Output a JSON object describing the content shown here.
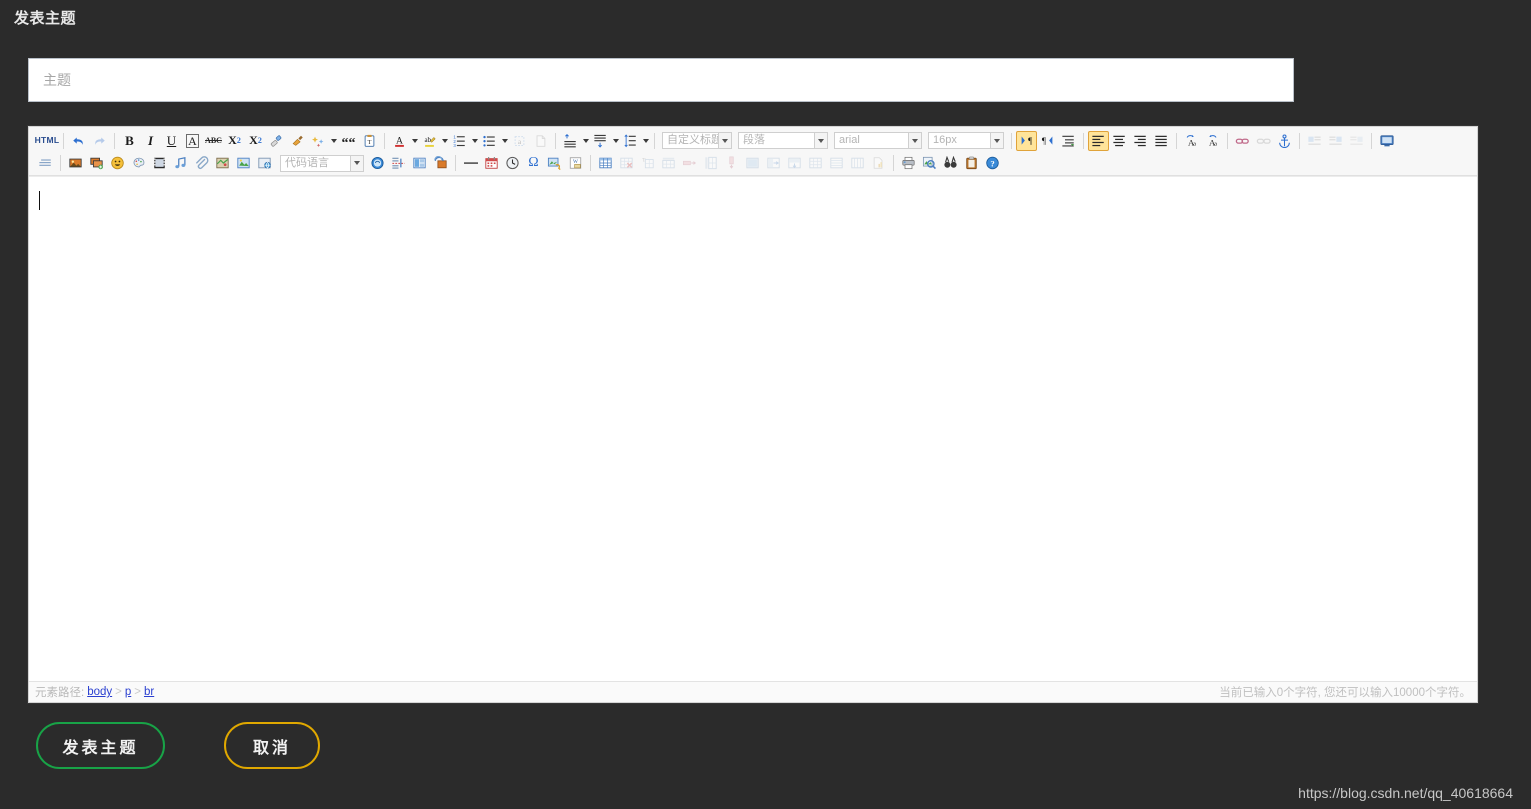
{
  "page": {
    "title": "发表主题",
    "watermark": "https://blog.csdn.net/qq_40618664"
  },
  "subject": {
    "placeholder": "主题",
    "value": ""
  },
  "editor": {
    "toolbar_row1": [
      {
        "name": "html-source-button",
        "label": "HTML",
        "kind": "text",
        "state": "normal"
      },
      {
        "name": "separator",
        "kind": "sep"
      },
      {
        "name": "undo-icon",
        "kind": "icon",
        "state": "normal"
      },
      {
        "name": "redo-icon",
        "kind": "icon",
        "state": "disabled"
      },
      {
        "name": "separator",
        "kind": "sep"
      },
      {
        "name": "bold-icon",
        "label": "B",
        "kind": "text",
        "state": "normal"
      },
      {
        "name": "italic-icon",
        "label": "I",
        "kind": "text",
        "state": "normal"
      },
      {
        "name": "underline-icon",
        "label": "U",
        "kind": "text",
        "state": "normal"
      },
      {
        "name": "font-border-icon",
        "label": "A",
        "kind": "text",
        "state": "normal"
      },
      {
        "name": "strikethrough-icon",
        "label": "ABC",
        "kind": "text",
        "state": "normal"
      },
      {
        "name": "superscript-icon",
        "kind": "icon",
        "state": "normal"
      },
      {
        "name": "subscript-icon",
        "kind": "icon",
        "state": "normal"
      },
      {
        "name": "remove-format-icon",
        "kind": "icon",
        "state": "normal"
      },
      {
        "name": "format-painter-icon",
        "kind": "icon",
        "state": "normal"
      },
      {
        "name": "auto-typeset-icon",
        "kind": "icon",
        "state": "normal"
      },
      {
        "name": "blockquote-icon",
        "kind": "icon",
        "state": "normal"
      },
      {
        "name": "paste-plain-text-icon",
        "kind": "icon",
        "state": "normal"
      },
      {
        "name": "separator",
        "kind": "sep"
      },
      {
        "name": "font-color-icon",
        "kind": "icon",
        "state": "normal"
      },
      {
        "name": "highlight-color-icon",
        "kind": "icon",
        "state": "normal"
      },
      {
        "name": "ordered-list-icon",
        "kind": "icon",
        "state": "normal"
      },
      {
        "name": "unordered-list-icon",
        "kind": "icon",
        "state": "normal"
      },
      {
        "name": "anchor-text-icon",
        "kind": "icon",
        "state": "disabled"
      },
      {
        "name": "blank-page-icon",
        "kind": "icon",
        "state": "disabled"
      },
      {
        "name": "separator",
        "kind": "sep"
      },
      {
        "name": "paragraph-spacing-top-icon",
        "kind": "icon",
        "state": "normal"
      },
      {
        "name": "paragraph-spacing-bottom-icon",
        "kind": "icon",
        "state": "normal"
      },
      {
        "name": "line-height-icon",
        "kind": "icon",
        "state": "normal"
      }
    ],
    "selects": [
      {
        "name": "custom-heading-select",
        "value": "自定义标题"
      },
      {
        "name": "paragraph-format-select",
        "value": "段落"
      },
      {
        "name": "font-family-select",
        "value": "arial"
      },
      {
        "name": "font-size-select",
        "value": "16px"
      }
    ],
    "toolbar_row1_right": [
      {
        "name": "direction-ltr-icon",
        "kind": "icon",
        "state": "active"
      },
      {
        "name": "direction-rtl-icon",
        "kind": "icon",
        "state": "normal"
      },
      {
        "name": "indent-icon",
        "kind": "icon",
        "state": "normal"
      },
      {
        "name": "separator",
        "kind": "sep"
      },
      {
        "name": "align-left-icon",
        "kind": "icon",
        "state": "active"
      },
      {
        "name": "align-center-icon",
        "kind": "icon",
        "state": "normal"
      },
      {
        "name": "align-right-icon",
        "kind": "icon",
        "state": "normal"
      },
      {
        "name": "align-justify-icon",
        "kind": "icon",
        "state": "normal"
      },
      {
        "name": "separator",
        "kind": "sep"
      },
      {
        "name": "uppercase-icon",
        "kind": "icon",
        "state": "normal"
      },
      {
        "name": "lowercase-icon",
        "kind": "icon",
        "state": "normal"
      },
      {
        "name": "insert-link-icon",
        "kind": "icon",
        "state": "normal"
      },
      {
        "name": "unlink-icon",
        "kind": "icon",
        "state": "disabled"
      },
      {
        "name": "anchor-icon",
        "kind": "icon",
        "state": "normal"
      },
      {
        "name": "separator",
        "kind": "sep"
      },
      {
        "name": "image-float-left-icon",
        "kind": "icon",
        "state": "disabled"
      },
      {
        "name": "image-float-right-icon",
        "kind": "icon",
        "state": "disabled"
      },
      {
        "name": "image-float-none-icon",
        "kind": "icon",
        "state": "disabled"
      },
      {
        "name": "fullscreen-icon",
        "kind": "icon",
        "state": "normal"
      }
    ],
    "toolbar_row2": [
      {
        "name": "text-indent-icon",
        "kind": "icon",
        "state": "normal"
      },
      {
        "name": "separator",
        "kind": "sep"
      },
      {
        "name": "insert-image-icon",
        "kind": "icon",
        "state": "normal"
      },
      {
        "name": "batch-image-icon",
        "kind": "icon",
        "state": "normal"
      },
      {
        "name": "emoticon-icon",
        "kind": "icon",
        "state": "normal"
      },
      {
        "name": "scrawl-icon",
        "kind": "icon",
        "state": "normal"
      },
      {
        "name": "insert-video-icon",
        "kind": "icon",
        "state": "normal"
      },
      {
        "name": "insert-music-icon",
        "kind": "icon",
        "state": "normal"
      },
      {
        "name": "attachment-icon",
        "kind": "icon",
        "state": "normal"
      },
      {
        "name": "map-icon",
        "kind": "icon",
        "state": "normal"
      },
      {
        "name": "insert-frame-icon",
        "kind": "icon",
        "state": "normal"
      },
      {
        "name": "webapp-icon",
        "kind": "icon",
        "state": "normal"
      }
    ],
    "code_language_select": {
      "name": "code-language-select",
      "value": "代码语言"
    },
    "toolbar_row2_mid": [
      {
        "name": "insert-code-icon",
        "kind": "icon",
        "state": "normal"
      },
      {
        "name": "page-break-icon",
        "kind": "icon",
        "state": "normal"
      },
      {
        "name": "template-icon",
        "kind": "icon",
        "state": "normal"
      },
      {
        "name": "background-icon",
        "kind": "icon",
        "state": "normal"
      },
      {
        "name": "separator",
        "kind": "sep"
      },
      {
        "name": "horizontal-rule-icon",
        "kind": "icon",
        "state": "normal"
      },
      {
        "name": "calendar-icon",
        "kind": "icon",
        "state": "normal"
      },
      {
        "name": "time-icon",
        "kind": "icon",
        "state": "normal"
      },
      {
        "name": "special-character-icon",
        "kind": "icon",
        "state": "normal"
      },
      {
        "name": "seo-icon",
        "kind": "icon",
        "state": "normal"
      },
      {
        "name": "import-word-icon",
        "kind": "icon",
        "state": "normal"
      },
      {
        "name": "separator",
        "kind": "sep"
      },
      {
        "name": "insert-table-icon",
        "kind": "icon",
        "state": "normal"
      },
      {
        "name": "delete-table-icon",
        "kind": "icon",
        "state": "disabled"
      },
      {
        "name": "table-title-icon",
        "kind": "icon",
        "state": "disabled"
      },
      {
        "name": "insert-row-icon",
        "kind": "icon",
        "state": "disabled"
      },
      {
        "name": "delete-row-icon",
        "kind": "icon",
        "state": "disabled"
      },
      {
        "name": "insert-col-icon",
        "kind": "icon",
        "state": "disabled"
      },
      {
        "name": "delete-col-icon",
        "kind": "icon",
        "state": "disabled"
      },
      {
        "name": "merge-cells-icon",
        "kind": "icon",
        "state": "disabled"
      },
      {
        "name": "merge-right-icon",
        "kind": "icon",
        "state": "disabled"
      },
      {
        "name": "merge-down-icon",
        "kind": "icon",
        "state": "disabled"
      },
      {
        "name": "split-cell-icon",
        "kind": "icon",
        "state": "disabled"
      },
      {
        "name": "split-rows-icon",
        "kind": "icon",
        "state": "disabled"
      },
      {
        "name": "split-cols-icon",
        "kind": "icon",
        "state": "disabled"
      },
      {
        "name": "table-sort-icon",
        "kind": "icon",
        "state": "disabled"
      },
      {
        "name": "separator",
        "kind": "sep"
      },
      {
        "name": "print-icon",
        "kind": "icon",
        "state": "normal"
      },
      {
        "name": "preview-icon",
        "kind": "icon",
        "state": "normal"
      },
      {
        "name": "search-replace-icon",
        "kind": "icon",
        "state": "normal"
      },
      {
        "name": "paste-icon",
        "kind": "icon",
        "state": "normal"
      },
      {
        "name": "help-icon",
        "kind": "icon",
        "state": "normal"
      }
    ],
    "content": "",
    "statusbar": {
      "path_label": "元素路径:",
      "path_nodes": [
        "body",
        "p",
        "br"
      ],
      "separator": ">",
      "char_count": "当前已输入0个字符, 您还可以输入10000个字符。"
    }
  },
  "actions": {
    "publish_label": "发表主题",
    "cancel_label": "取消"
  },
  "colors": {
    "background": "#2b2b2b",
    "publish_border": "#18a347",
    "cancel_border": "#e0a800",
    "toolbar_active": "#ffe49a",
    "link": "#2a3fd0"
  }
}
